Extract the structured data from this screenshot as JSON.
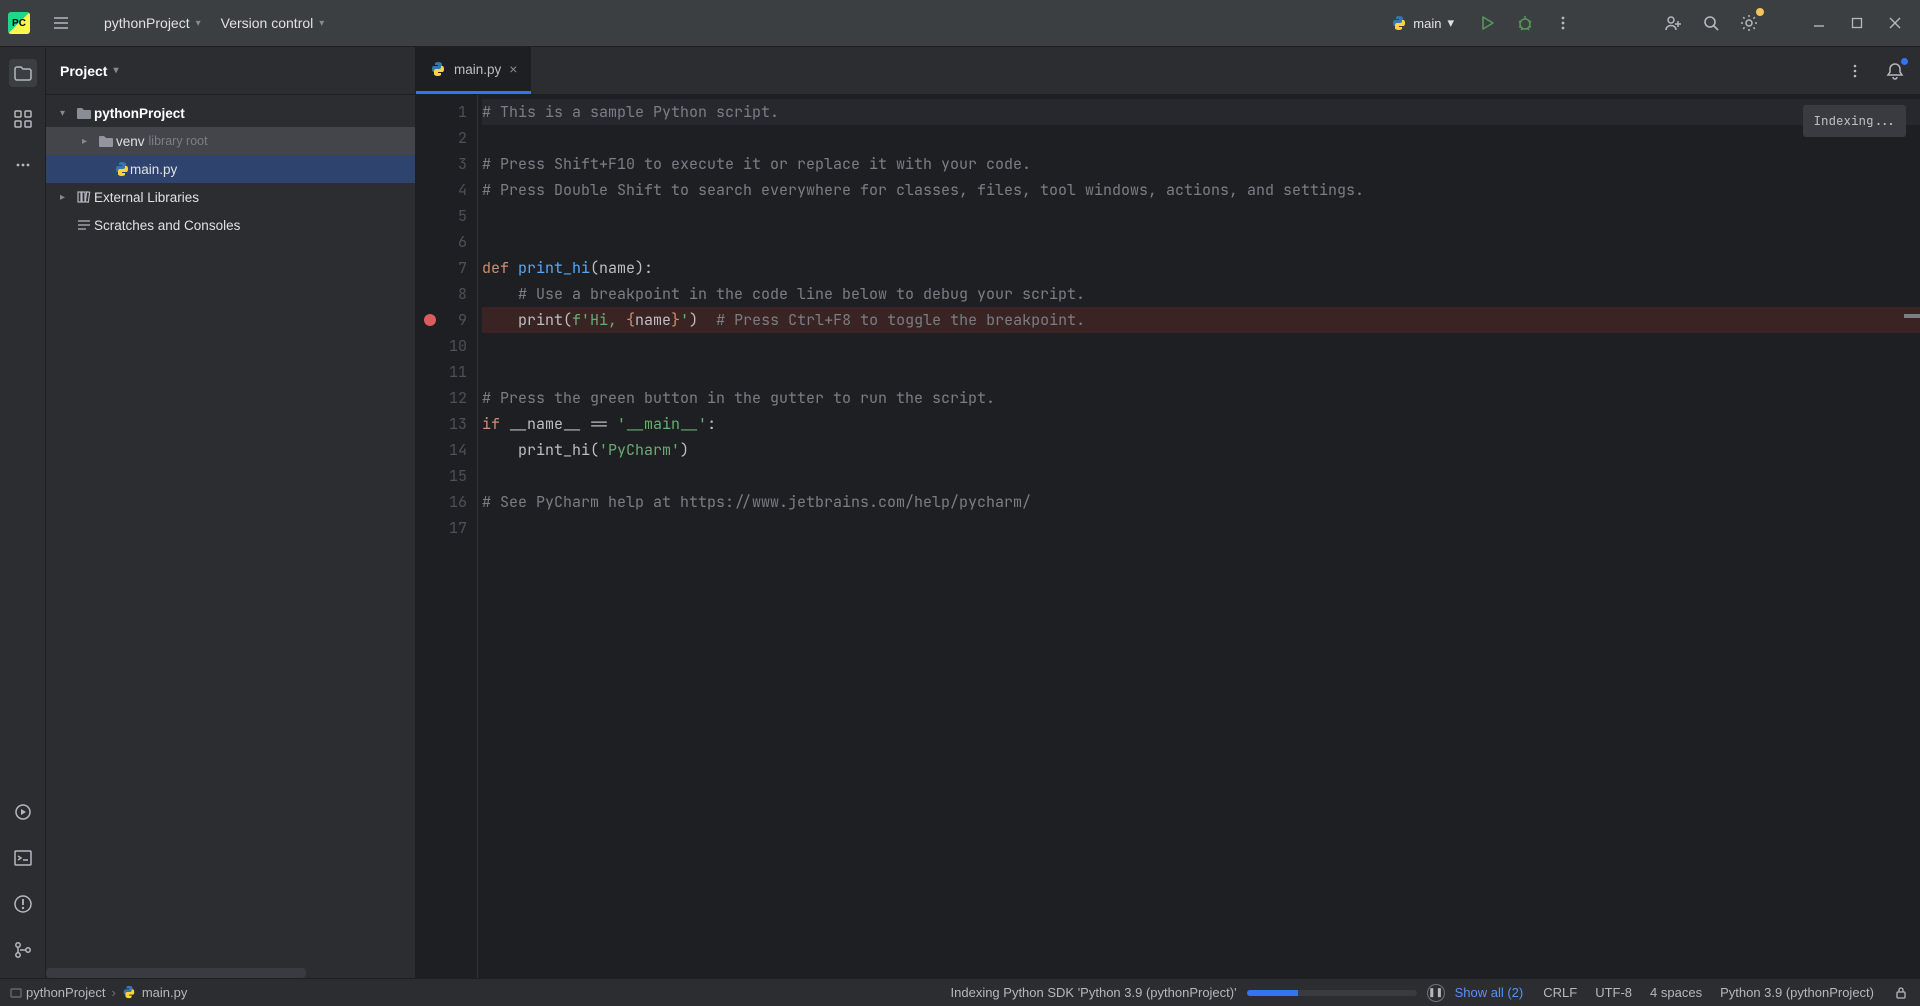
{
  "topbar": {
    "project_name": "pythonProject",
    "vcs_label": "Version control",
    "run_config": "main"
  },
  "project_panel": {
    "title": "Project",
    "tree": {
      "root": "pythonProject",
      "venv": "venv",
      "venv_hint": "library root",
      "main_file": "main.py",
      "ext_lib": "External Libraries",
      "scratches": "Scratches and Consoles"
    }
  },
  "tabs": {
    "active": "main.py"
  },
  "editor_status": "Indexing...",
  "code": {
    "l1": "# This is a sample Python script.",
    "l3": "# Press Shift+F10 to execute it or replace it with your code.",
    "l4": "# Press Double Shift to search everywhere for classes, files, tool windows, actions, and settings.",
    "l7_def": "def ",
    "l7_fn": "print_hi",
    "l7_rest": "(name):",
    "l8": "    # Use a breakpoint in the code line below to debug your script.",
    "l9_a": "    print(",
    "l9_b": "f'Hi, ",
    "l9_c": "{",
    "l9_d": "name",
    "l9_e": "}",
    "l9_f": "'",
    "l9_g": ")",
    "l9_cmt": "  # Press Ctrl+F8 to toggle the breakpoint.",
    "l12": "# Press the green button in the gutter to run the script.",
    "l13_if": "if ",
    "l13_name": "__name__ ",
    "l13_eq": "== ",
    "l13_str": "'__main__'",
    "l13_colon": ":",
    "l14_a": "    print_hi(",
    "l14_b": "'PyCharm'",
    "l14_c": ")",
    "l16": "# See PyCharm help at https://www.jetbrains.com/help/pycharm/"
  },
  "statusbar": {
    "crumb1": "pythonProject",
    "crumb2": "main.py",
    "indexing_text": "Indexing Python SDK 'Python 3.9 (pythonProject)'",
    "show_all": "Show all (2)",
    "line_sep": "CRLF",
    "encoding": "UTF-8",
    "indent": "4 spaces",
    "interpreter": "Python 3.9 (pythonProject)"
  }
}
